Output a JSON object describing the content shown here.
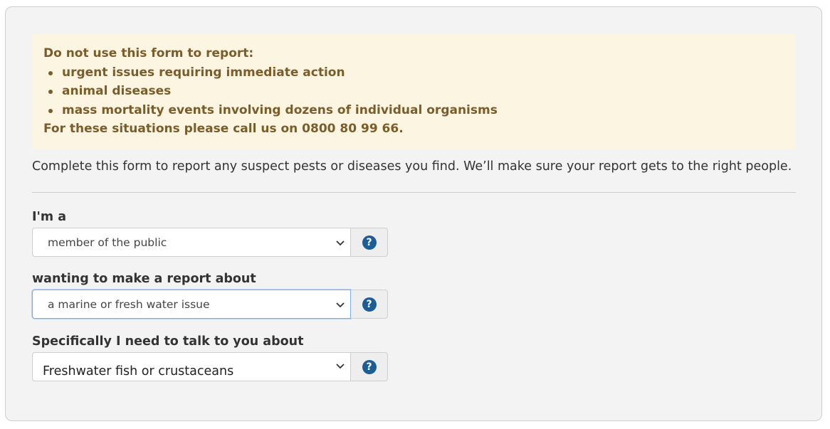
{
  "warning": {
    "heading": "Do not use this form to report:",
    "items": [
      "urgent issues requiring immediate action",
      "animal diseases",
      "mass mortality events involving dozens of individual organisms"
    ],
    "footer": "For these situations please call us on 0800 80 99 66."
  },
  "intro": "Complete this form to report any suspect pests or diseases you find. We’ll make sure your report gets to the right people.",
  "fields": [
    {
      "label": "I'm a",
      "value": "member of the public",
      "icon": "help-icon"
    },
    {
      "label": "wanting to make a report about",
      "value": "a marine or fresh water issue",
      "icon": "help-icon"
    },
    {
      "label": "Specifically I need to talk to you about",
      "value": "Freshwater fish or crustaceans",
      "icon": "help-icon"
    }
  ],
  "help_glyph": "?",
  "colors": {
    "warning_bg": "#fcf5e2",
    "warning_text": "#7a5d2a",
    "help_icon": "#1c5d96",
    "focus_border": "#80aee4"
  }
}
